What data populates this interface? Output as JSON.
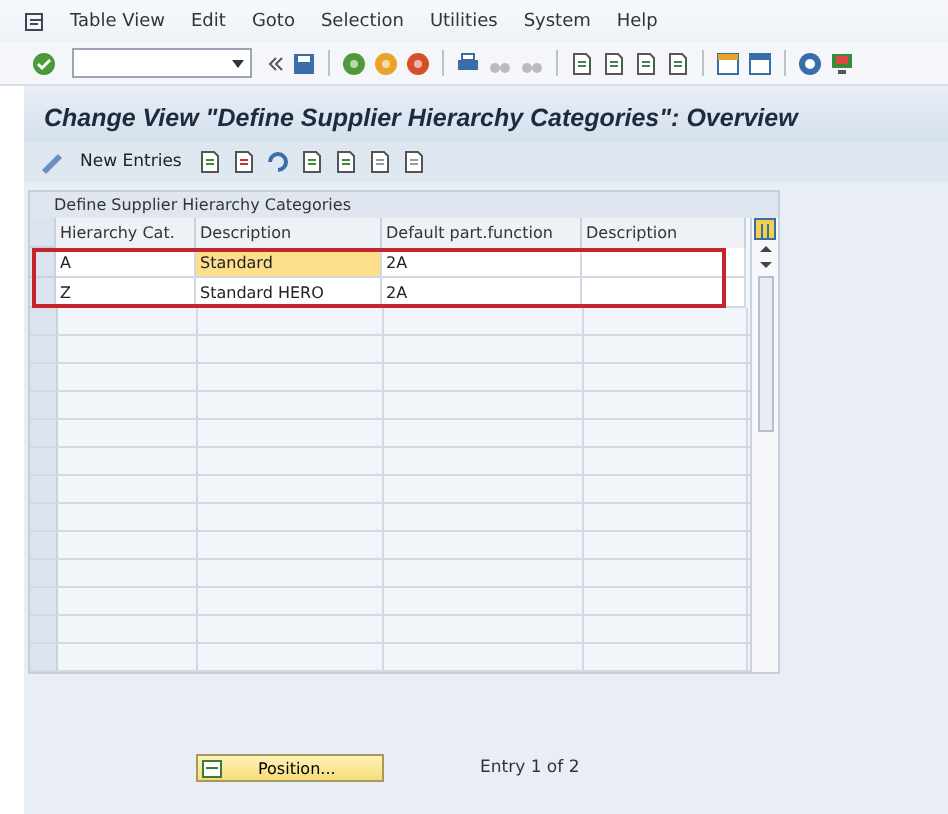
{
  "menu_bar": {
    "items": [
      "Table View",
      "Edit",
      "Goto",
      "Selection",
      "Utilities",
      "System",
      "Help"
    ]
  },
  "screen": {
    "title": "Change View \"Define Supplier Hierarchy Categories\": Overview"
  },
  "app_toolbar": {
    "items": [
      {
        "label": "New Entries"
      }
    ]
  },
  "table": {
    "caption": "Define Supplier Hierarchy Categories",
    "columns": [
      "Hierarchy Cat.",
      "Description",
      "Default part.function",
      "Description"
    ],
    "rows": [
      {
        "cells": [
          {
            "text": "A",
            "selected": false
          },
          {
            "text": "Standard",
            "selected": true
          },
          {
            "text": "2A",
            "selected": false
          },
          {
            "text": "",
            "selected": false
          }
        ]
      },
      {
        "cells": [
          {
            "text": "Z",
            "selected": false
          },
          {
            "text": "Standard HERO",
            "selected": false
          },
          {
            "text": "2A",
            "selected": false
          },
          {
            "text": "",
            "selected": false
          }
        ]
      }
    ]
  },
  "footer": {
    "position_button": "Position...",
    "entry_info": "Entry 1 of 2"
  }
}
